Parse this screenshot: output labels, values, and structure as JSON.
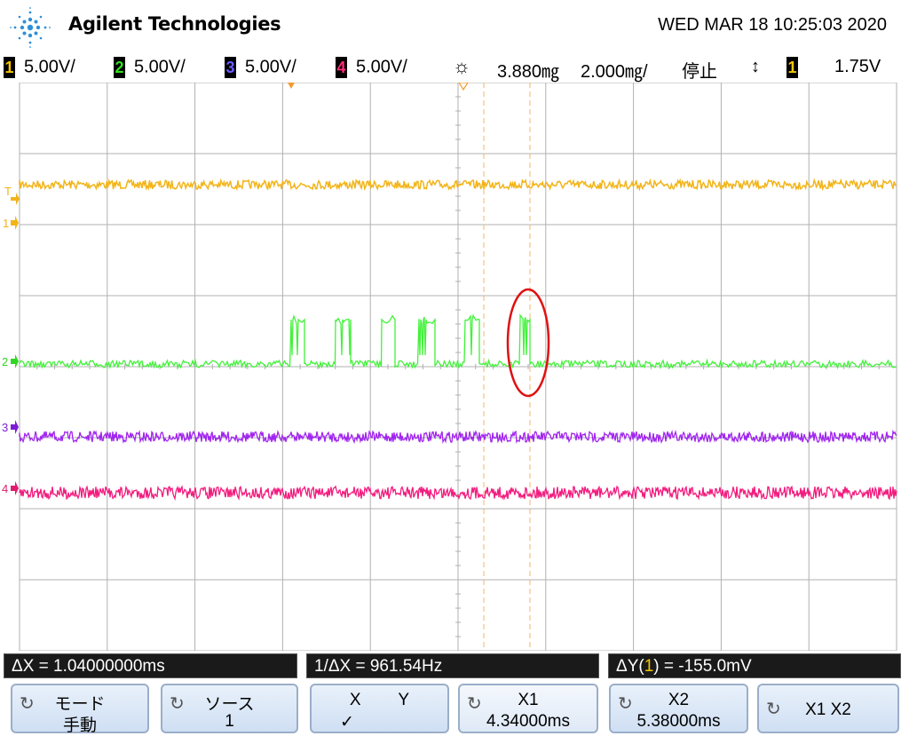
{
  "header": {
    "brand": "Agilent Technologies",
    "datetime": "WED MAR 18 10:25:03 2020"
  },
  "status": {
    "channels": [
      {
        "num": "1",
        "scale": "5.00V/",
        "color": "#f7c600"
      },
      {
        "num": "2",
        "scale": "5.00V/",
        "color": "#32e01e"
      },
      {
        "num": "3",
        "scale": "5.00V/",
        "color": "#6a5cff"
      },
      {
        "num": "4",
        "scale": "5.00V/",
        "color": "#ff2a78"
      }
    ],
    "time_offset": "3.880㎎",
    "time_scale": "2.000㎎/",
    "run_state": "停止",
    "trigger_source": "1",
    "trigger_level": "1.75V"
  },
  "traces": {
    "ch1_color": "#f2b418",
    "ch2_color": "#42f23a",
    "ch3_color": "#a124f0",
    "ch4_color": "#f31c7e"
  },
  "markers": {
    "ch1": "1",
    "ch2": "2",
    "ch3": "3",
    "ch4": "4",
    "trigger": "T"
  },
  "measurements": {
    "delta_x": "ΔX = 1.04000000ms",
    "inv_delta_x": "1/ΔX = 961.54Hz",
    "delta_y_prefix": "ΔY(",
    "delta_y_channel": "1",
    "delta_y_suffix": ") = -155.0mV"
  },
  "softkeys": [
    {
      "l1": "モード",
      "l2": "手動"
    },
    {
      "l1": "ソース",
      "l2": "1"
    },
    {
      "l1": "X        Y",
      "l2": "✓"
    },
    {
      "l1": "X1",
      "l2": "4.34000ms"
    },
    {
      "l1": "X2",
      "l2": "5.38000ms"
    },
    {
      "l1": "X1 X2",
      "l2": ""
    }
  ]
}
